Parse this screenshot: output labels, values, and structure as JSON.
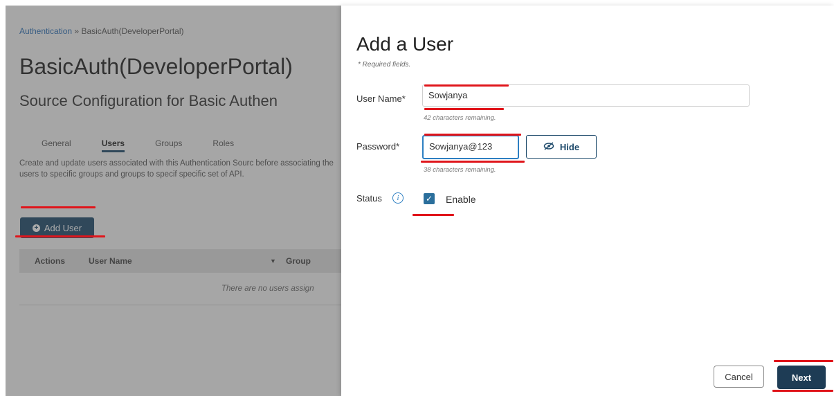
{
  "background": {
    "breadcrumb": {
      "root": "Authentication",
      "separator": "»",
      "current": "BasicAuth(DeveloperPortal)"
    },
    "title": "BasicAuth(DeveloperPortal)",
    "subtitle": "Source Configuration for Basic Authen",
    "tabs": [
      {
        "label": "General"
      },
      {
        "label": "Users"
      },
      {
        "label": "Groups"
      },
      {
        "label": "Roles"
      }
    ],
    "description": "Create and update users associated with this Authentication Sourc before associating the users to specific groups and groups to specif specific set of API.",
    "add_user_label": "Add User",
    "table": {
      "columns": [
        "Actions",
        "User Name",
        "Group"
      ],
      "empty_text": "There are no users assign"
    }
  },
  "modal": {
    "title": "Add a User",
    "required_note": "* Required fields.",
    "username": {
      "label": "User Name*",
      "value": "Sowjanya",
      "hint": "42 characters remaining."
    },
    "password": {
      "label": "Password*",
      "value": "Sowjanya@123",
      "hint": "38 characters remaining.",
      "toggle_label": "Hide"
    },
    "status": {
      "label": "Status",
      "checkbox_label": "Enable",
      "checked": true
    },
    "cancel_label": "Cancel",
    "next_label": "Next"
  },
  "colors": {
    "primary": "#1e4a6b",
    "focus": "#2d7fc2",
    "annotation": "#e0151b"
  },
  "icons": [
    "plus-circle-icon",
    "sort-arrow-icon",
    "eye-slash-icon",
    "info-icon",
    "checkmark-icon"
  ]
}
